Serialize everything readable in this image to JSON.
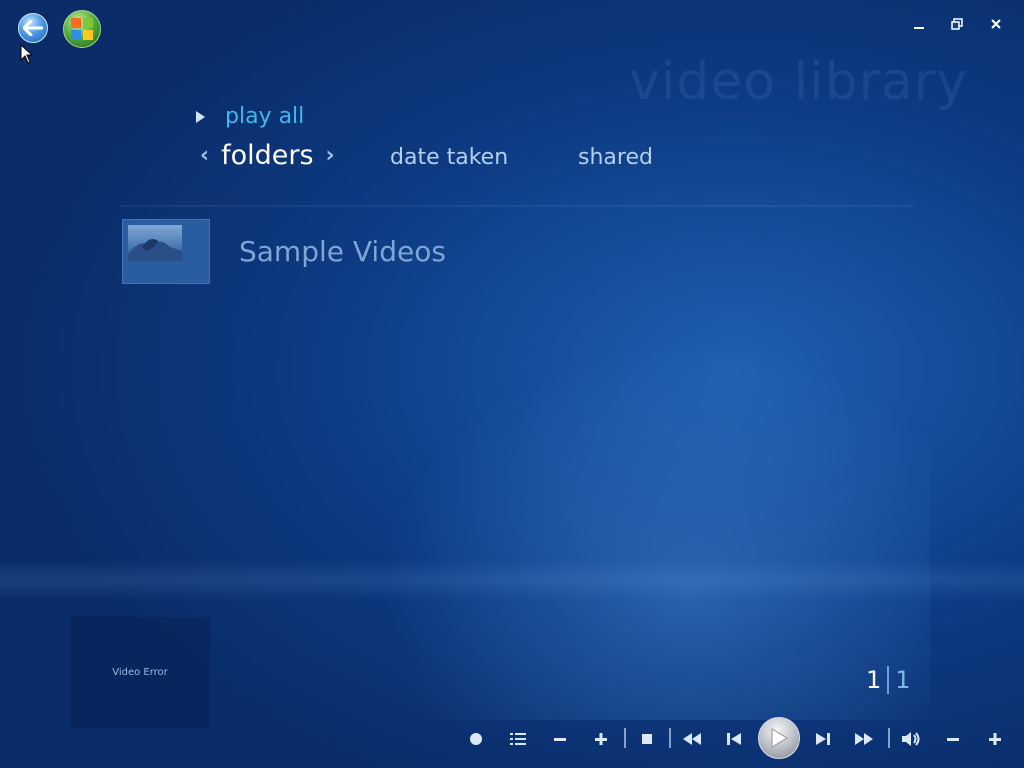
{
  "page": {
    "watermark": "video library"
  },
  "nav": {
    "play_all": "play all"
  },
  "pivot": {
    "active": "folders",
    "items": [
      "date taken",
      "shared"
    ]
  },
  "folders": [
    {
      "label": "Sample Videos"
    }
  ],
  "inset": {
    "status": "Video Error"
  },
  "pager": {
    "current": "1",
    "total": "1"
  },
  "icons": {
    "back": "back-arrow-icon",
    "start": "windows-orb-icon",
    "minimize": "minimize-icon",
    "maximize": "restore-icon",
    "close": "close-icon"
  },
  "colors": {
    "accent": "#42b7ee",
    "background": "#0d3a82",
    "pivot_inactive": "#b4d1f1",
    "folder_label": "#7fa5d4"
  }
}
